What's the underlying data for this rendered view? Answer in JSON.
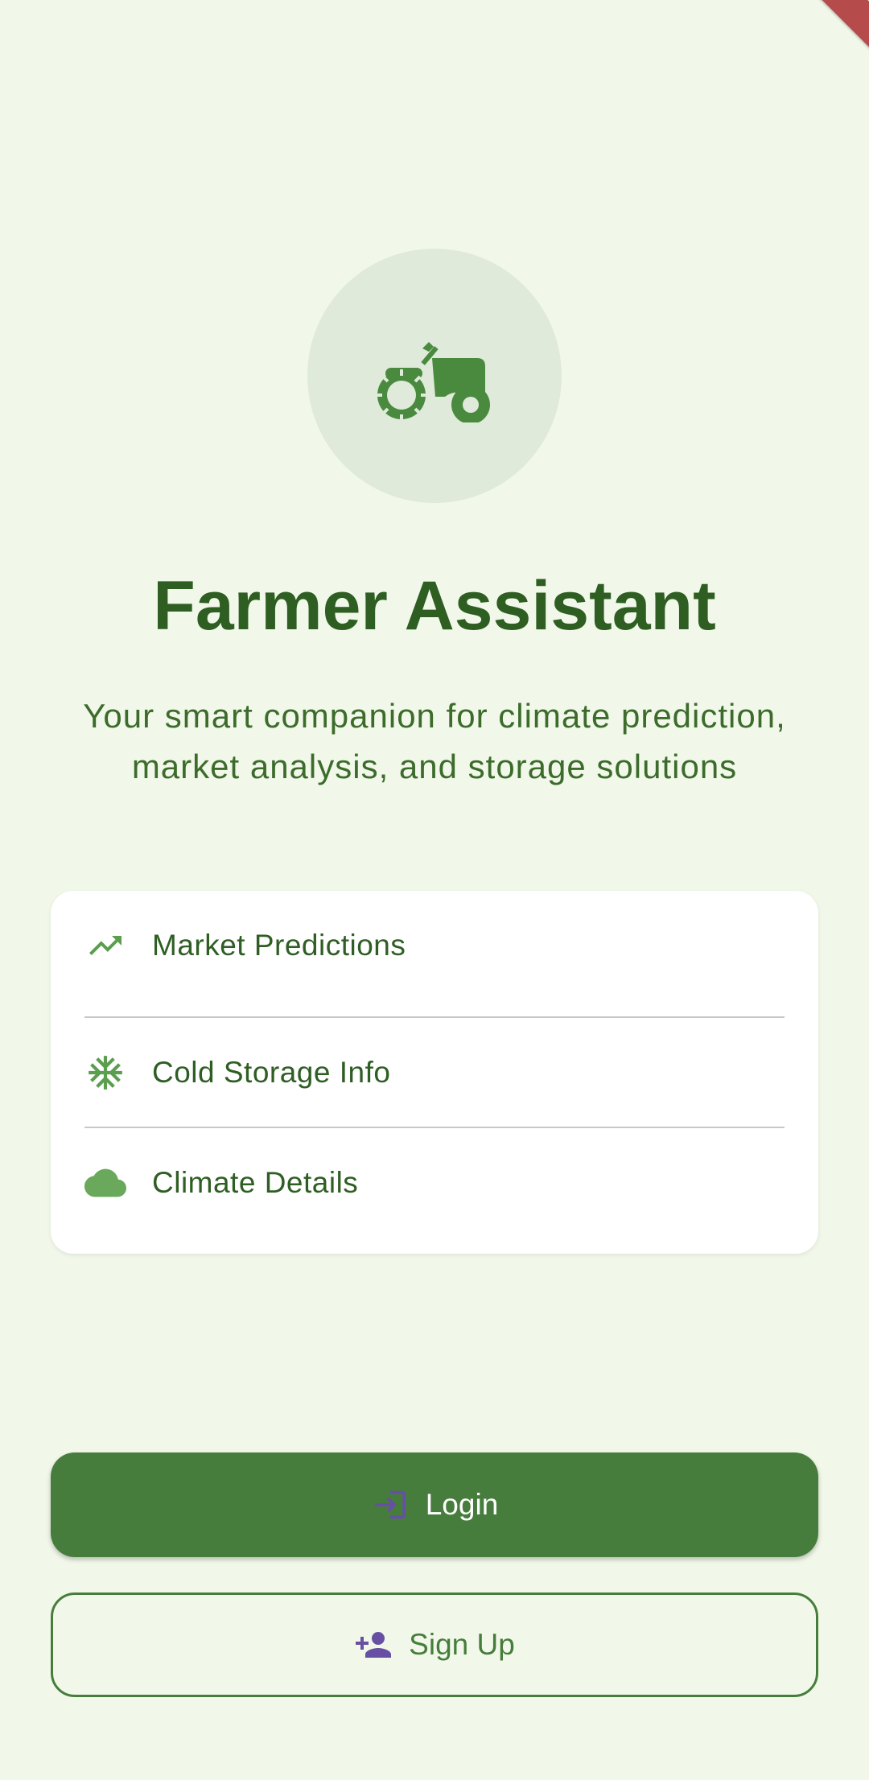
{
  "app": {
    "title": "Farmer Assistant",
    "subtitle": "Your smart companion for climate prediction, market analysis, and storage solutions",
    "logo_icon": "tractor-icon"
  },
  "features": [
    {
      "label": "Market Predictions",
      "icon": "trending-up-icon"
    },
    {
      "label": "Cold Storage Info",
      "icon": "snowflake-icon"
    },
    {
      "label": "Climate Details",
      "icon": "cloud-icon"
    }
  ],
  "buttons": {
    "login_label": "Login",
    "login_icon": "login-icon",
    "signup_label": "Sign Up",
    "signup_icon": "person-add-icon"
  },
  "colors": {
    "background": "#f1f8e9",
    "primary": "#477d3c",
    "title": "#2e5e22",
    "icon_green": "#5a9e4e",
    "button_icon": "#6750a4",
    "debug_ribbon": "#b64b4b"
  }
}
